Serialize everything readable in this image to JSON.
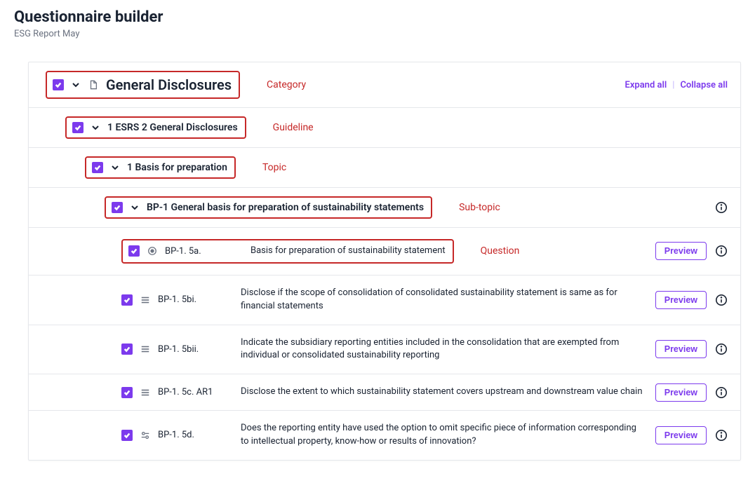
{
  "header": {
    "title": "Questionnaire builder",
    "subtitle": "ESG Report May"
  },
  "actions": {
    "expand_all": "Expand all",
    "collapse_all": "Collapse all",
    "preview": "Preview"
  },
  "annotations": {
    "category": "Category",
    "guideline": "Guideline",
    "topic": "Topic",
    "subtopic": "Sub-topic",
    "question": "Question"
  },
  "tree": {
    "category": {
      "label": "General Disclosures"
    },
    "guideline": {
      "label": "1 ESRS 2 General Disclosures"
    },
    "topic": {
      "label": "1 Basis for preparation"
    },
    "subtopic": {
      "code": "BP-1",
      "label": "General basis for preparation of sustainability statements"
    }
  },
  "questions": [
    {
      "code": "BP-1. 5a.",
      "text": "Basis for preparation of sustainability statement",
      "highlighted": true,
      "type": "radio"
    },
    {
      "code": "BP-1. 5bi.",
      "text": "Disclose if the scope of consolidation of consolidated sustainability statement is same as for financial statements",
      "type": "list"
    },
    {
      "code": "BP-1. 5bii.",
      "text": "Indicate the subsidiary reporting entities included in the consolidation that are exempted from individual or consolidated sustainability reporting",
      "type": "list"
    },
    {
      "code": "BP-1. 5c. AR1",
      "text": "Disclose the extent to which sustainability statement covers upstream and downstream value chain",
      "type": "list"
    },
    {
      "code": "BP-1. 5d.",
      "text": "Does the reporting entity have used the option to omit specific piece of information corresponding to intellectual property, know-how or results of innovation?",
      "type": "toggle"
    }
  ]
}
